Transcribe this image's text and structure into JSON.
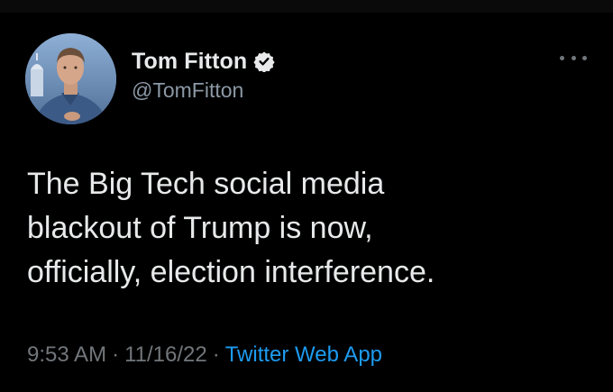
{
  "author": {
    "display_name": "Tom Fitton",
    "handle": "@TomFitton",
    "verified": true
  },
  "tweet": {
    "lines": [
      "The Big Tech social media",
      "blackout of Trump is now,",
      "officially, election interference."
    ]
  },
  "meta": {
    "time": "9:53 AM",
    "date": "11/16/22",
    "separator": "·",
    "source": "Twitter Web App"
  },
  "icons": {
    "verified": "verified-badge-icon",
    "more": "more-options-icon"
  },
  "colors": {
    "background": "#000000",
    "text": "#e7e9ea",
    "secondary": "#71767b",
    "link": "#1d9bf0"
  }
}
